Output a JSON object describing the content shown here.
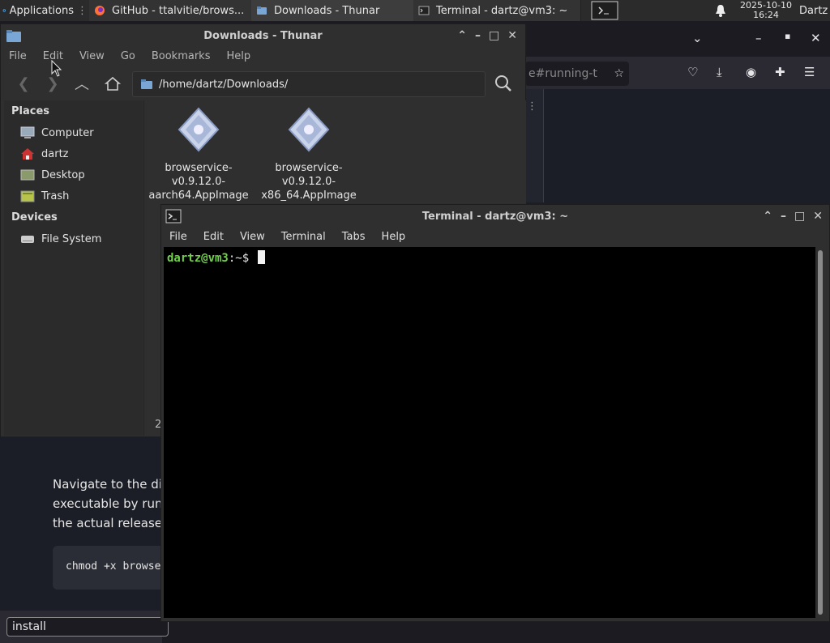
{
  "panel": {
    "apps_label": "Applications",
    "tasks": [
      {
        "label": "GitHub - ttalvitie/brows...",
        "icon": "firefox-icon"
      },
      {
        "label": "Downloads - Thunar",
        "icon": "folder-icon"
      },
      {
        "label": "Terminal - dartz@vm3: ~",
        "icon": "terminal-icon"
      }
    ],
    "clock_date": "2025-10-10",
    "clock_time": "16:24",
    "user": "Dartz"
  },
  "firefox": {
    "url_fragment": "e#running-t",
    "doc_lines": [
      "Navigate to the dire",
      "executable by runni",
      "the actual release ."
    ],
    "code": "chmod +x browse",
    "find_value": "install"
  },
  "thunar": {
    "title": "Downloads - Thunar",
    "menu": [
      "File",
      "Edit",
      "View",
      "Go",
      "Bookmarks",
      "Help"
    ],
    "path": "/home/dartz/Downloads/",
    "places_label": "Places",
    "places": [
      {
        "label": "Computer",
        "icon": "computer-icon"
      },
      {
        "label": "dartz",
        "icon": "home-icon"
      },
      {
        "label": "Desktop",
        "icon": "desktop-icon"
      },
      {
        "label": "Trash",
        "icon": "trash-icon"
      }
    ],
    "devices_label": "Devices",
    "devices": [
      {
        "label": "File System",
        "icon": "drive-icon"
      }
    ],
    "files": [
      {
        "line1": "browservice-",
        "line2": "v0.9.12.0-",
        "line3": "aarch64.AppImage"
      },
      {
        "line1": "browservice-",
        "line2": "v0.9.12.0-",
        "line3": "x86_64.AppImage"
      }
    ],
    "status": "2"
  },
  "terminal": {
    "title": "Terminal - dartz@vm3: ~",
    "menu": [
      "File",
      "Edit",
      "View",
      "Terminal",
      "Tabs",
      "Help"
    ],
    "prompt_user": "dartz@vm3",
    "prompt_path": ":~",
    "prompt_symbol": "$"
  },
  "colors": {
    "prompt_user": "#6fd14a",
    "prompt_path": "#6b9bd6",
    "terminal_bg": "#000000",
    "window_bg": "#2f2f2f"
  }
}
